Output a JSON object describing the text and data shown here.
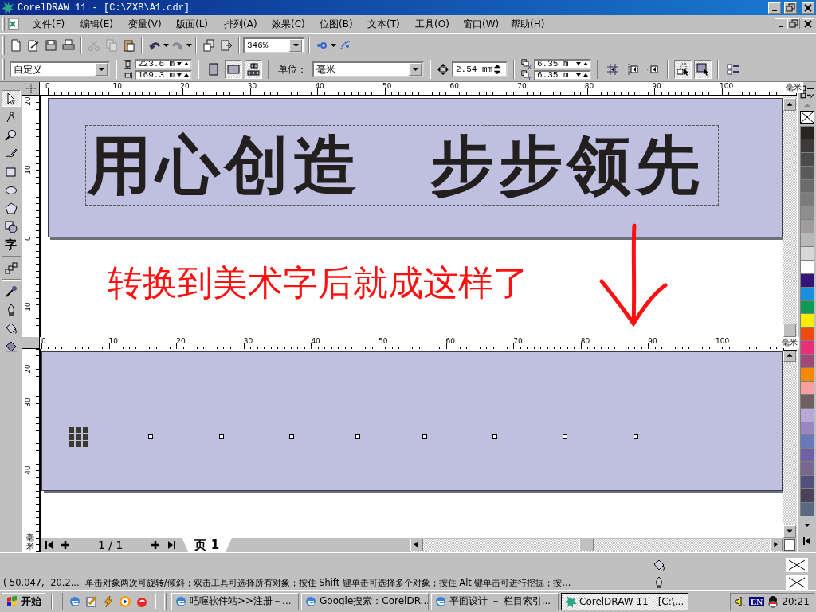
{
  "window": {
    "title": "CorelDRAW 11 - [C:\\ZXB\\A1.cdr]"
  },
  "menu": [
    {
      "label": "文件(F)"
    },
    {
      "label": "编辑(E)"
    },
    {
      "label": "变量(V)"
    },
    {
      "label": "版面(L)"
    },
    {
      "label": "排列(A)"
    },
    {
      "label": "效果(C)"
    },
    {
      "label": "位图(B)"
    },
    {
      "label": "文本(T)"
    },
    {
      "label": "工具(O)"
    },
    {
      "label": "窗口(W)"
    },
    {
      "label": "帮助(H)"
    }
  ],
  "standard_toolbar": {
    "buttons": [
      {
        "kind": "new",
        "disabled": false
      },
      {
        "kind": "open",
        "disabled": false
      },
      {
        "kind": "save",
        "disabled": false
      },
      {
        "kind": "print",
        "disabled": false
      },
      {
        "kind": "cut",
        "disabled": true
      },
      {
        "kind": "copy",
        "disabled": true
      },
      {
        "kind": "paste",
        "disabled": false
      },
      {
        "kind": "undo",
        "disabled": false
      },
      {
        "kind": "redo",
        "disabled": true
      },
      {
        "kind": "import",
        "disabled": false
      },
      {
        "kind": "export",
        "disabled": false
      }
    ],
    "zoom": "346%"
  },
  "property_bar": {
    "paper_size": "自定义",
    "width": "223.6 m",
    "height": "169.3 m",
    "layout": [
      {
        "kind": "portrait",
        "selected": false
      },
      {
        "kind": "landscape",
        "selected": true
      },
      {
        "kind": "pages",
        "selected": true
      }
    ],
    "units_label": "单位：",
    "units": "毫米",
    "nudge": "2.54 mm",
    "duplicate_x": "6.35 m",
    "duplicate_y": "6.35 m",
    "toggles": [
      {
        "kind": "grid",
        "selected": false
      },
      {
        "kind": "guides",
        "selected": false
      },
      {
        "kind": "objects",
        "selected": false
      },
      {
        "kind": "treat_filled",
        "selected": true
      },
      {
        "kind": "draw_fill",
        "selected": true
      },
      {
        "kind": "options",
        "selected": false
      }
    ]
  },
  "tools": [
    {
      "kind": "pick",
      "selected": true
    },
    {
      "kind": "shape",
      "selected": false
    },
    {
      "kind": "zoom",
      "selected": false
    },
    {
      "kind": "freehand",
      "selected": false
    },
    {
      "kind": "rectangle",
      "selected": false
    },
    {
      "kind": "ellipse",
      "selected": false
    },
    {
      "kind": "polygon",
      "selected": false
    },
    {
      "kind": "shapes",
      "selected": false
    },
    {
      "kind": "text",
      "label": "字",
      "selected": false
    },
    {
      "kind": "blend",
      "selected": false
    },
    {
      "kind": "eyedropper",
      "selected": false
    },
    {
      "kind": "outline",
      "selected": false
    },
    {
      "kind": "fill",
      "selected": false
    },
    {
      "kind": "interactive_fill",
      "selected": false
    }
  ],
  "canvas": {
    "top_ruler": [
      "0",
      "10",
      "20",
      "30",
      "40",
      "50",
      "60",
      "70",
      "80",
      "90",
      "100"
    ],
    "top_ruler_unit": "毫米",
    "left_ruler": [
      "20",
      "10",
      "0",
      "10"
    ],
    "artwork": [
      "用心创造",
      "步步领先"
    ],
    "annotation": "转换到美术字后就成这样了",
    "second_ruler": [
      "0",
      "10",
      "20",
      "30",
      "40",
      "50",
      "60",
      "70",
      "80",
      "90",
      "100"
    ],
    "second_ruler_unit": "毫米",
    "lower_left_ruler": [
      "20",
      "30",
      "40"
    ],
    "lower_left_ruler_unit": "毫米"
  },
  "page_nav": {
    "position": "1 / 1",
    "tabs": [
      {
        "label": "页 1",
        "selected": true
      }
    ]
  },
  "palette": [
    {
      "color": "#282422"
    },
    {
      "color": "#3f3a3a"
    },
    {
      "color": "#4d4a4a"
    },
    {
      "color": "#5a5a5a"
    },
    {
      "color": "#6b6b6b"
    },
    {
      "color": "#7b7b7b"
    },
    {
      "color": "#8e8e8e"
    },
    {
      "color": "#a09c9c"
    },
    {
      "color": "#b8b8b8"
    },
    {
      "color": "#d8d8d8"
    },
    {
      "color": "#ffffff"
    },
    {
      "color": "#36157a"
    },
    {
      "color": "#1a8fe0"
    },
    {
      "color": "#0d9a55"
    },
    {
      "color": "#f8ec00"
    },
    {
      "color": "#f04a10"
    },
    {
      "color": "#e8307a"
    },
    {
      "color": "#a04878"
    },
    {
      "color": "#f58a00"
    },
    {
      "color": "#f8a0a0"
    },
    {
      "color": "#6e6060"
    },
    {
      "color": "#b8a8d8"
    },
    {
      "color": "#9888c0"
    },
    {
      "color": "#6878b8"
    },
    {
      "color": "#7060a8"
    },
    {
      "color": "#786890"
    },
    {
      "color": "#50507a"
    },
    {
      "color": "#4a4258"
    },
    {
      "color": "#5a6880"
    }
  ],
  "status_bar": {
    "coordinates": "( 50.047, -20.2...",
    "hint": "单击对象两次可旋转/倾斜；双击工具可选择所有对象；按住 Shift 键单击可选择多个对象；按住 Alt 键单击可进行挖掘；按..."
  },
  "taskbar": {
    "start": "开始",
    "tasks": [
      {
        "kind": "browser",
        "label": "吧喔软件站>>注册－...",
        "selected": false
      },
      {
        "kind": "browser",
        "label": "Google搜索：CorelDR...",
        "selected": false
      },
      {
        "kind": "browser",
        "label": "平面设计 － 栏目索引...",
        "selected": false
      },
      {
        "kind": "corel",
        "label": "CorelDRAW 11 - [C:\\...",
        "selected": true
      }
    ],
    "ime": "EN",
    "clock": "20:21"
  }
}
